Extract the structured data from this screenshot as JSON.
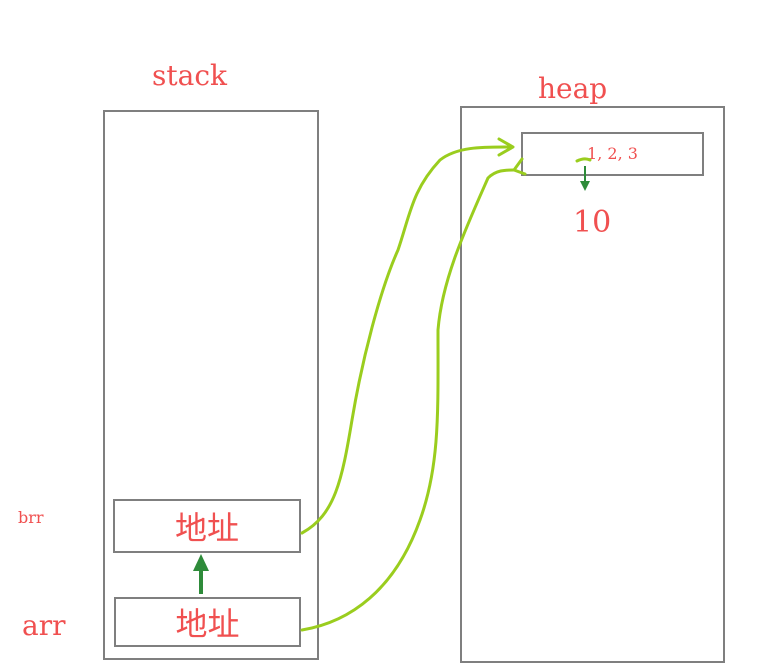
{
  "stack": {
    "title": "stack"
  },
  "heap": {
    "title": "heap",
    "array_values": "1, 2, 3",
    "new_value": "10"
  },
  "variables": {
    "brr": {
      "name": "brr",
      "cell_text": "地址"
    },
    "arr": {
      "name": "arr",
      "cell_text": "地址"
    }
  },
  "colors": {
    "label": "#f05050",
    "box_border": "#7f7f7f",
    "reference_arrow": "#9acd1e",
    "assign_arrow": "#2e8b3a"
  }
}
